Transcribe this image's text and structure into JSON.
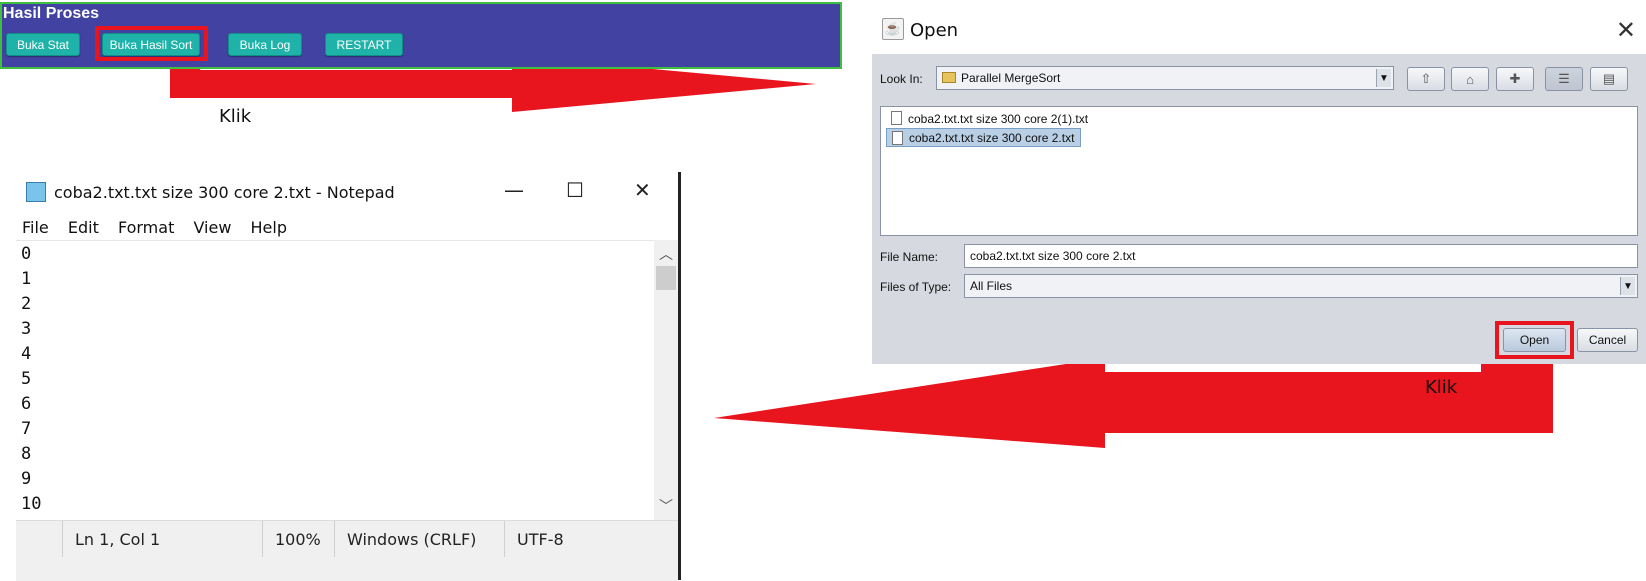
{
  "proses": {
    "title": "Hasil Proses",
    "buttons": [
      "Buka Stat",
      "Buka Hasil Sort",
      "Buka Log",
      "RESTART"
    ]
  },
  "annotations": {
    "klik_1": "Klik",
    "klik_2": "Klik"
  },
  "colors": {
    "arrow_red": "#e8141e",
    "panel_blue": "#4242a2",
    "button_teal": "#1fb2a8"
  },
  "dialog": {
    "title": "Open",
    "look_in_label": "Look In:",
    "look_in_value": "Parallel MergeSort",
    "toolbar_icons": [
      "up-folder-icon",
      "home-icon",
      "new-folder-icon",
      "list-view-icon",
      "details-view-icon"
    ],
    "files": [
      "coba2.txt.txt size 300 core 2(1).txt",
      "coba2.txt.txt size 300 core 2.txt"
    ],
    "selected_file_index": 1,
    "file_name_label": "File Name:",
    "file_name_value": "coba2.txt.txt size 300 core 2.txt",
    "files_of_type_label": "Files of Type:",
    "files_of_type_value": "All Files",
    "open_label": "Open",
    "cancel_label": "Cancel"
  },
  "notepad": {
    "title": "coba2.txt.txt size 300 core 2.txt - Notepad",
    "menu": [
      "File",
      "Edit",
      "Format",
      "View",
      "Help"
    ],
    "lines": [
      "0",
      "1",
      "2",
      "3",
      "4",
      "5",
      "6",
      "7",
      "8",
      "9",
      "10"
    ],
    "status": {
      "position": "Ln 1, Col 1",
      "zoom": "100%",
      "line_ending": "Windows (CRLF)",
      "encoding": "UTF-8"
    }
  }
}
